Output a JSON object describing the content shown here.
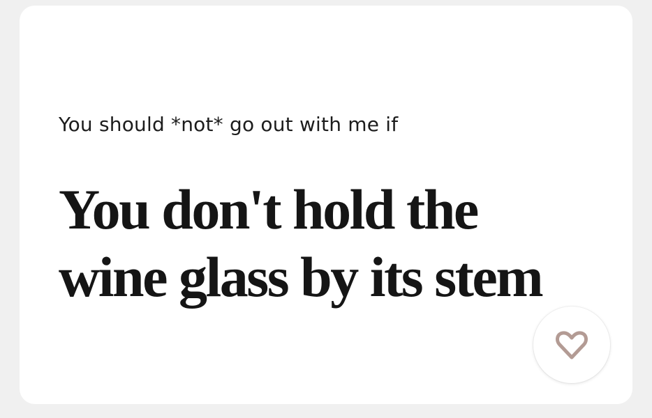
{
  "prompt": {
    "question": "You should *not* go out with me if",
    "answer": "You don't hold the wine glass by its stem"
  },
  "like_button": {
    "icon": "heart-outline-icon",
    "icon_color": "#b39b94"
  },
  "colors": {
    "background": "#f0f0f0",
    "card": "#ffffff",
    "text": "#151515"
  }
}
